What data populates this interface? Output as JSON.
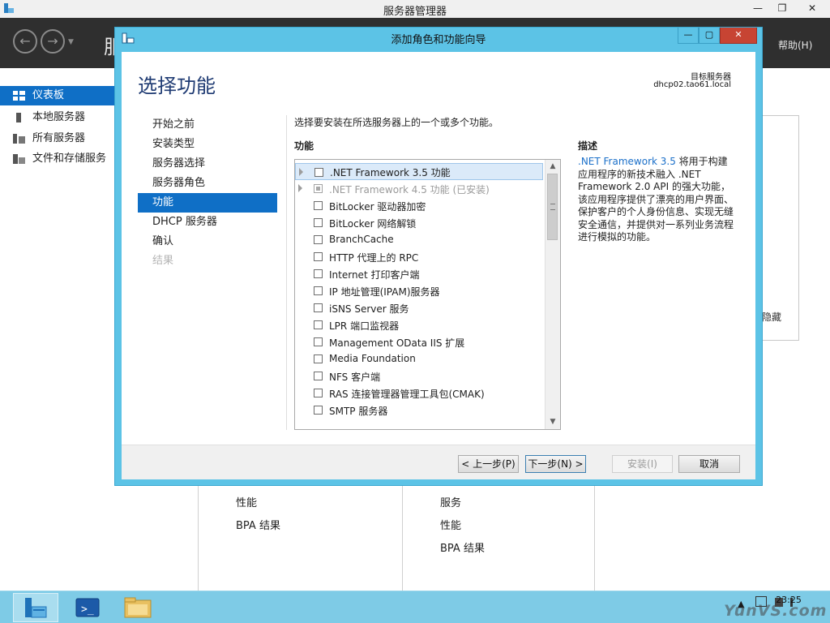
{
  "window": {
    "title": "服务器管理器",
    "min_label": "—",
    "max_label": "❐",
    "close_label": "✕"
  },
  "header": {
    "back_label": "←",
    "forward_label": "→",
    "dropdown_label": "▼",
    "title": "服",
    "partial_right": "I)",
    "help": "帮助(H)"
  },
  "sidebar": {
    "items": [
      {
        "label": "仪表板",
        "icon": "dashboard-icon",
        "active": true
      },
      {
        "label": "本地服务器",
        "icon": "server-icon",
        "active": false
      },
      {
        "label": "所有服务器",
        "icon": "servers-icon",
        "active": false
      },
      {
        "label": "文件和存储服务",
        "icon": "storage-icon",
        "active": false
      }
    ]
  },
  "content": {
    "hide_label": "隐藏",
    "lower_left": [
      "性能",
      "BPA 结果"
    ],
    "lower_right": [
      "服务",
      "性能",
      "BPA 结果"
    ]
  },
  "dialog": {
    "title": "添加角色和功能向导",
    "min_label": "—",
    "max_label": "▢",
    "close_label": "✕",
    "heading": "选择功能",
    "target_label": "目标服务器",
    "target_value": "dhcp02.tao61.local",
    "steps": [
      {
        "label": "开始之前",
        "state": "normal"
      },
      {
        "label": "安装类型",
        "state": "normal"
      },
      {
        "label": "服务器选择",
        "state": "normal"
      },
      {
        "label": "服务器角色",
        "state": "normal"
      },
      {
        "label": "功能",
        "state": "active"
      },
      {
        "label": "DHCP 服务器",
        "state": "normal"
      },
      {
        "label": "确认",
        "state": "normal"
      },
      {
        "label": "结果",
        "state": "disabled"
      }
    ],
    "instruction": "选择要安装在所选服务器上的一个或多个功能。",
    "features_header": "功能",
    "features": [
      {
        "label": ".NET Framework 3.5 功能",
        "expandable": true,
        "checked": false,
        "selected": true,
        "disabled": false
      },
      {
        "label": ".NET Framework 4.5 功能 (已安装)",
        "expandable": true,
        "checked": "indeterminate",
        "selected": false,
        "disabled": true
      },
      {
        "label": "BitLocker 驱动器加密",
        "expandable": false,
        "checked": false,
        "selected": false,
        "disabled": false
      },
      {
        "label": "BitLocker 网络解锁",
        "expandable": false,
        "checked": false,
        "selected": false,
        "disabled": false
      },
      {
        "label": "BranchCache",
        "expandable": false,
        "checked": false,
        "selected": false,
        "disabled": false
      },
      {
        "label": "HTTP 代理上的 RPC",
        "expandable": false,
        "checked": false,
        "selected": false,
        "disabled": false
      },
      {
        "label": "Internet 打印客户端",
        "expandable": false,
        "checked": false,
        "selected": false,
        "disabled": false
      },
      {
        "label": "IP 地址管理(IPAM)服务器",
        "expandable": false,
        "checked": false,
        "selected": false,
        "disabled": false
      },
      {
        "label": "iSNS Server 服务",
        "expandable": false,
        "checked": false,
        "selected": false,
        "disabled": false
      },
      {
        "label": "LPR 端口监视器",
        "expandable": false,
        "checked": false,
        "selected": false,
        "disabled": false
      },
      {
        "label": "Management OData IIS 扩展",
        "expandable": false,
        "checked": false,
        "selected": false,
        "disabled": false
      },
      {
        "label": "Media Foundation",
        "expandable": false,
        "checked": false,
        "selected": false,
        "disabled": false
      },
      {
        "label": "NFS 客户端",
        "expandable": false,
        "checked": false,
        "selected": false,
        "disabled": false
      },
      {
        "label": "RAS 连接管理器管理工具包(CMAK)",
        "expandable": false,
        "checked": false,
        "selected": false,
        "disabled": false
      },
      {
        "label": "SMTP 服务器",
        "expandable": false,
        "checked": false,
        "selected": false,
        "disabled": false
      }
    ],
    "scroll_up": "▲",
    "scroll_down": "▼",
    "description_header": "描述",
    "description_highlight": ".NET Framework 3.5",
    "description_text": " 将用于构建应用程序的新技术融入 .NET Framework 2.0 API 的强大功能，该应用程序提供了漂亮的用户界面、保护客户的个人身份信息、实现无缝安全通信，并提供对一系列业务流程进行模拟的功能。",
    "buttons": {
      "previous": "< 上一步(P)",
      "next": "下一步(N) >",
      "install": "安装(I)",
      "cancel": "取消"
    }
  },
  "taskbar": {
    "apps": [
      {
        "name": "server-manager-taskbar-icon",
        "active": true
      },
      {
        "name": "powershell-taskbar-icon",
        "active": false
      },
      {
        "name": "explorer-taskbar-icon",
        "active": false
      }
    ],
    "tray_expand": "▲",
    "clock": "23:25"
  },
  "watermark": "YunVS.com",
  "colors": {
    "accent": "#0f6fc6",
    "dialog_frame": "#5cc3e6",
    "close_red": "#c74433",
    "taskbar": "#7ecbe6",
    "header_dark": "#2f2f2f"
  }
}
